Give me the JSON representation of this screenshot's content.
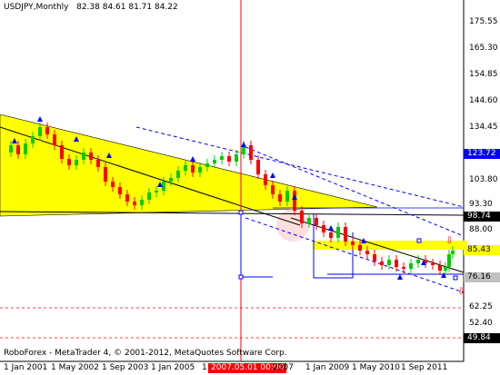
{
  "header": {
    "symbol_timeframe": "USDJPY,Monthly",
    "ohlc": "82.38 84.61 81.71 84.22"
  },
  "footer": {
    "copyright": "RoboForex - MetaTrader 4, © 2001-2012, MetaQuotes Software Corp."
  },
  "price_axis": {
    "labels": [
      "175.55",
      "165.30",
      "154.85",
      "144.60",
      "134.45",
      "113.95",
      "93.30",
      "72.90",
      "52.40",
      "62.25"
    ],
    "tags": {
      "level_123": {
        "text": "123.72",
        "color": "#0000ff"
      },
      "level_98": {
        "text": "98.74",
        "color": "#000000"
      },
      "level_85": {
        "text": "85.43",
        "color": "#ffff00"
      },
      "level_76": {
        "text": "76.16",
        "color": "#c0c0c0"
      },
      "level_49": {
        "text": "49.84",
        "color": "#000000"
      }
    },
    "misc": {
      "text_103": "103.80",
      "text_88": "88.00"
    }
  },
  "time_axis": {
    "labels": [
      "1 Jan 2001",
      "1 May 2002",
      "1 Sep 2003",
      "1 Jan 2005",
      "2007",
      "1 Jan 2009",
      "1 May 2010",
      "1 Sep 2011"
    ],
    "cursor": "2007.05.01 00:00",
    "cursor_prefix": "1"
  },
  "colors": {
    "bull": "#00cc00",
    "bear": "#ff0000",
    "triangle_fill": "#ffff00",
    "channel": "#0000ff",
    "crosshair": "#ff0000"
  },
  "chart_data": {
    "type": "candlestick",
    "title": "USDJPY,Monthly",
    "xlabel": "",
    "ylabel": "",
    "x": [
      "2001-01",
      "2002-05",
      "2003-09",
      "2005-01",
      "2007-05",
      "2009-01",
      "2010-05",
      "2011-09"
    ],
    "approx_close": [
      118,
      129,
      116,
      103,
      120,
      90,
      92,
      78
    ],
    "ylim": [
      45,
      180
    ],
    "grid": false,
    "levels": [
      123.72,
      98.74,
      85.43,
      76.16,
      62.25,
      49.84
    ]
  }
}
